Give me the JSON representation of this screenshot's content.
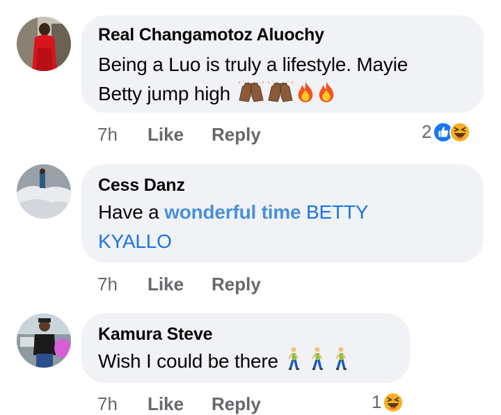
{
  "comments": [
    {
      "author": "Real Changamotoz Aluochy",
      "line1": "Being a Luo is truly a lifestyle. Mayie",
      "line2": "Betty jump high",
      "time": "7h",
      "like": "Like",
      "reply": "Reply",
      "reaction_count": "2",
      "emojis": [
        "raising-hands-icon",
        "raising-hands-icon",
        "fire-icon",
        "fire-icon"
      ],
      "reactions": [
        "like-reaction-icon",
        "haha-reaction-icon"
      ]
    },
    {
      "author": "Cess Danz",
      "prefix": "Have a ",
      "highlight": "wonderful time",
      "mention_1": " BETTY",
      "mention_2": "KYALLO",
      "time": "7h",
      "like": "Like",
      "reply": "Reply"
    },
    {
      "author": "Kamura Steve",
      "line1": "Wish I could be there",
      "time": "7h",
      "like": "Like",
      "reply": "Reply",
      "reaction_count": "1",
      "emojis": [
        "walking-person-icon",
        "walking-person-icon",
        "walking-person-icon"
      ],
      "reactions": [
        "haha-reaction-icon"
      ]
    }
  ],
  "colors": {
    "bubble": "#f0f2f5",
    "meta_text": "#65676b",
    "mention": "#1b74e4",
    "highlight": "#4a90d9",
    "like_blue": "#1877f2",
    "haha_yellow": "#f7b125"
  }
}
